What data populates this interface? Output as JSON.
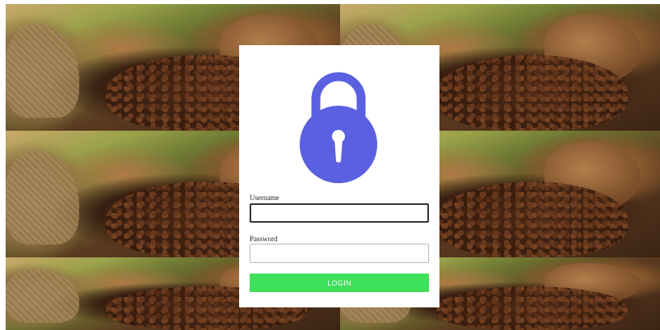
{
  "login": {
    "username_label": "Username",
    "username_value": "",
    "password_label": "Password",
    "password_value": "",
    "button_label": "LOGIN"
  },
  "icons": {
    "lock": "padlock-icon"
  },
  "colors": {
    "lock": "#5a60e0",
    "button": "#3fe05a",
    "page_background": "#ffffff",
    "panel": "#ffffff"
  }
}
